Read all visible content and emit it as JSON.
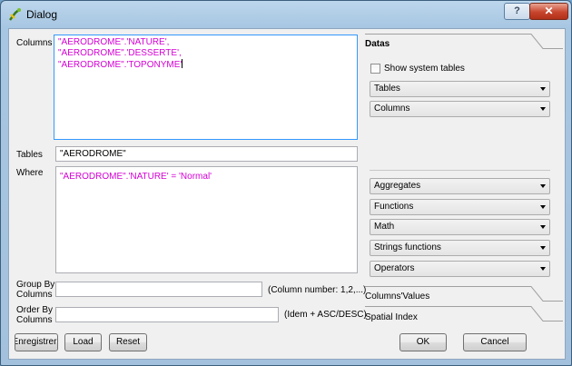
{
  "window": {
    "title": "Dialog",
    "help_label": "?",
    "close_label": "✕"
  },
  "labels": {
    "columns": "Columns",
    "tables": "Tables",
    "where": "Where",
    "group_by_1": "Group By",
    "group_by_2": "Columns",
    "order_by_1": "Order By",
    "order_by_2": "Columns"
  },
  "fields": {
    "columns_lines": [
      "\"AERODROME\".'NATURE',",
      "\"AERODROME\".'DESSERTE',",
      "\"AERODROME\".'TOPONYME'"
    ],
    "tables_value": "\"AERODROME\"",
    "where_value": "\"AERODROME\".'NATURE' = 'Normal'",
    "group_by_value": "",
    "order_by_value": "",
    "group_by_hint": "(Column number: 1,2,...)",
    "order_by_hint": "(Idem + ASC/DESC)"
  },
  "right_panel": {
    "datas_title": "Datas",
    "show_system_tables": "Show system tables",
    "show_system_tables_checked": false,
    "tables_combo": "Tables",
    "columns_combo": "Columns",
    "aggregates_combo": "Aggregates",
    "functions_combo": "Functions",
    "math_combo": "Math",
    "strings_combo": "Strings functions",
    "operators_combo": "Operators",
    "columns_values_title": "Columns'Values",
    "spatial_index_title": "Spatial Index"
  },
  "buttons": {
    "enregistrer": "Enregistrer",
    "load": "Load",
    "reset": "Reset",
    "ok": "OK",
    "cancel": "Cancel"
  }
}
